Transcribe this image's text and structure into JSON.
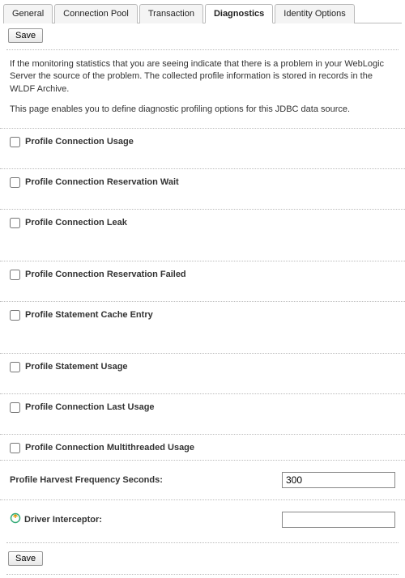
{
  "tabs": {
    "general": "General",
    "connection_pool": "Connection Pool",
    "transaction": "Transaction",
    "diagnostics": "Diagnostics",
    "identity_options": "Identity Options"
  },
  "buttons": {
    "save": "Save"
  },
  "intro": {
    "p1": "If the monitoring statistics that you are seeing indicate that there is a problem in your WebLogic Server the source of the problem. The collected profile information is stored in records in the WLDF Archive.",
    "p2": "This page enables you to define diagnostic profiling options for this JDBC data source."
  },
  "options": {
    "profile_connection_usage": "Profile Connection Usage",
    "profile_connection_reservation_wait": "Profile Connection Reservation Wait",
    "profile_connection_leak": "Profile Connection Leak",
    "profile_connection_reservation_failed": "Profile Connection Reservation Failed",
    "profile_statement_cache_entry": "Profile Statement Cache Entry",
    "profile_statement_usage": "Profile Statement Usage",
    "profile_connection_last_usage": "Profile Connection Last Usage",
    "profile_connection_multithreaded_usage": "Profile Connection Multithreaded Usage"
  },
  "fields": {
    "harvest_label": "Profile Harvest Frequency Seconds:",
    "harvest_value": "300",
    "driver_interceptor_label": "Driver Interceptor:",
    "driver_interceptor_value": ""
  }
}
